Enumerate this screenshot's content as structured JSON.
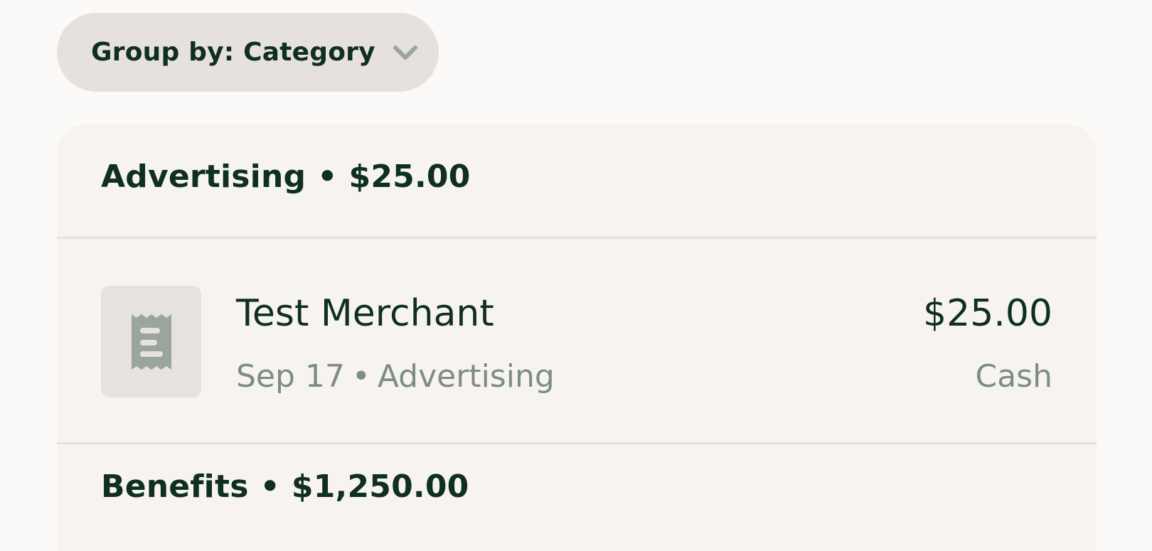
{
  "group_by": {
    "label": "Group by: Category",
    "icon": "chevron-down-icon"
  },
  "groups": [
    {
      "name": "Advertising",
      "total": "$25.00",
      "transactions": [
        {
          "icon": "receipt-icon",
          "merchant": "Test Merchant",
          "date": "Sep 17",
          "category": "Advertising",
          "amount": "$25.00",
          "payment_method": "Cash"
        }
      ]
    },
    {
      "name": "Benefits",
      "total": "$1,250.00",
      "transactions": []
    }
  ],
  "separator": "•",
  "colors": {
    "page_background": "#FBFAF8",
    "card_background": "#F7F4F0",
    "pill_background": "#E6E1DC",
    "primary_text": "#0F2F22",
    "secondary_text": "#7D8C86",
    "icon_gray": "#9AA59E"
  }
}
